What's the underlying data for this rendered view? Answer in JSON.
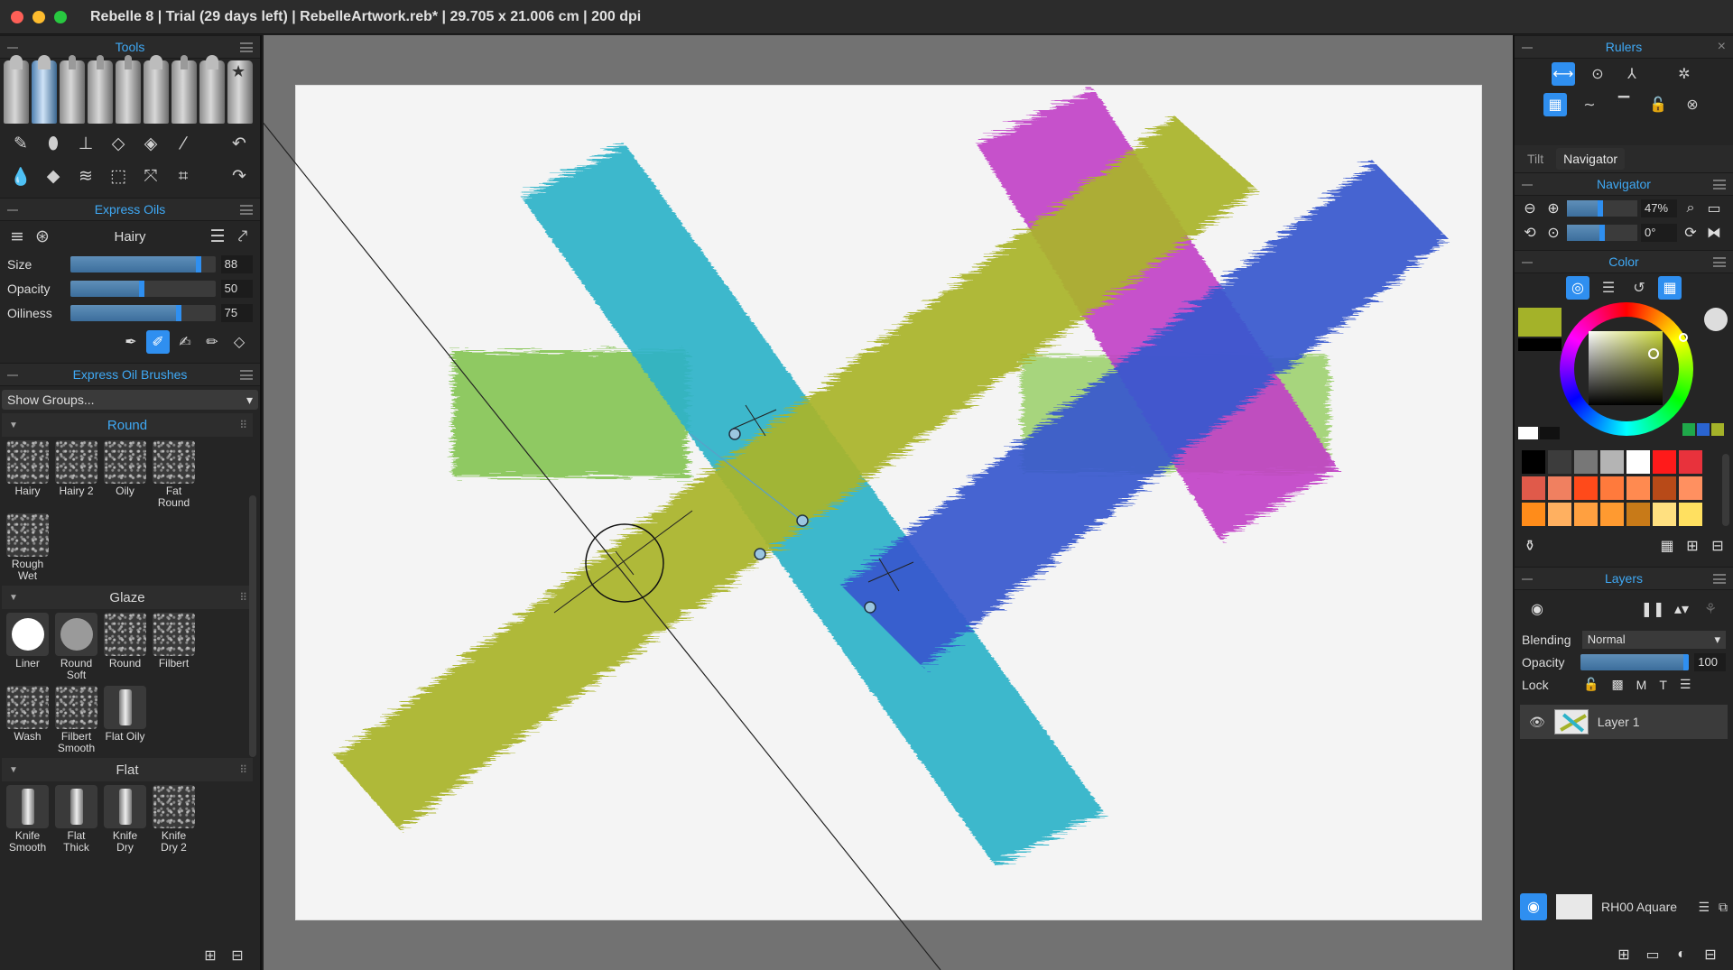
{
  "window": {
    "title": "Rebelle 8 | Trial (29 days left) | RebelleArtwork.reb* | 29.705 x 21.006 cm | 200 dpi"
  },
  "tools_panel": {
    "title": "Tools"
  },
  "brush_panel": {
    "title": "Express Oils",
    "preset_name": "Hairy",
    "sliders": [
      {
        "label": "Size",
        "value": "88",
        "fraction": 0.88
      },
      {
        "label": "Opacity",
        "value": "50",
        "fraction": 0.5
      },
      {
        "label": "Oiliness",
        "value": "75",
        "fraction": 0.75
      }
    ]
  },
  "brushes_panel": {
    "title": "Express Oil Brushes",
    "show_groups": "Show Groups...",
    "groups": [
      {
        "name": "Round",
        "brushes": [
          "Hairy",
          "Hairy 2",
          "Oily",
          "Fat Round",
          "Rough Wet"
        ]
      },
      {
        "name": "Glaze",
        "brushes": [
          "Liner",
          "Round Soft",
          "Round",
          "Filbert",
          "Wash",
          "Filbert Smooth",
          "Flat Oily"
        ]
      },
      {
        "name": "Flat",
        "brushes": [
          "Knife Smooth",
          "Flat Thick",
          "Knife Dry",
          "Knife Dry 2"
        ]
      }
    ]
  },
  "rulers_panel": {
    "title": "Rulers"
  },
  "tabs": {
    "tilt": "Tilt",
    "navigator": "Navigator"
  },
  "navigator": {
    "title": "Navigator",
    "zoom": "47%",
    "rotation": "0°",
    "zoom_fraction": 0.47
  },
  "color_panel": {
    "title": "Color",
    "current_color": "#a4b229",
    "swatches": [
      "#000000",
      "#3c3c3c",
      "#777777",
      "#b4b4b4",
      "#ffffff",
      "#ff1a1a",
      "#e8323c",
      "#e05a4a",
      "#f08060",
      "#ff4a1a",
      "#ff7a3c",
      "#ff8a50",
      "#b84a18",
      "#ff9060",
      "#ff8c1a",
      "#ffb060",
      "#ffa040",
      "#ff9a30",
      "#c87a18",
      "#ffe080",
      "#ffe060"
    ]
  },
  "layers_panel": {
    "title": "Layers",
    "blending_label": "Blending",
    "blending_value": "Normal",
    "opacity_label": "Opacity",
    "opacity_value": "100",
    "lock_label": "Lock",
    "lock_m": "M",
    "lock_t": "T",
    "layers": [
      {
        "name": "Layer 1"
      }
    ],
    "paper_name": "RH00 Aquare"
  }
}
